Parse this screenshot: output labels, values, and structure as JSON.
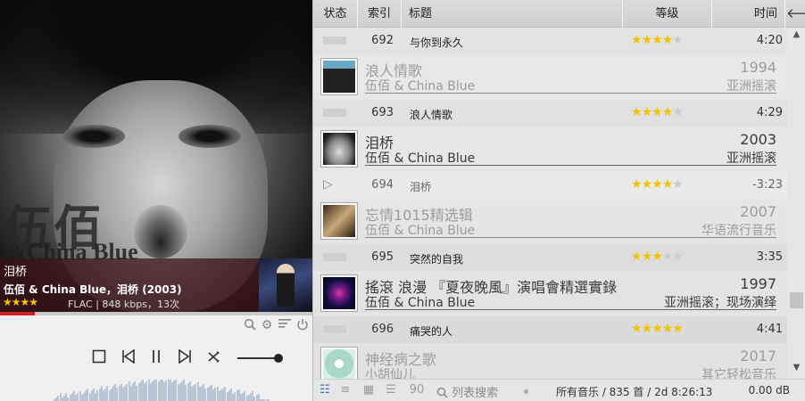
{
  "now_playing": {
    "title": "泪桥",
    "artist_line": "伍佰 & China Blue，泪桥 (2003)",
    "rating_stars": "★★★★",
    "rating": 4,
    "format_info": "FLAC | 848 kbps，13次",
    "progress_fraction": 0.11,
    "cover_text_1": "伍佰",
    "cover_text_2": "&China Blue"
  },
  "controls": {
    "volume_fraction": 0.95
  },
  "header": {
    "status": "状态",
    "index": "索引",
    "title": "标题",
    "rating": "等级",
    "time": "时间"
  },
  "rows": [
    {
      "kind": "track",
      "index": "692",
      "title": "与你到永久",
      "rating": 4,
      "duration": "4:20"
    },
    {
      "kind": "album",
      "name": "浪人情歌",
      "artist": "伍佰 & China Blue",
      "year": "1994",
      "genre": "亚洲摇滚",
      "style": "dim",
      "thumb": "t1"
    },
    {
      "kind": "track",
      "index": "693",
      "title": "浪人情歌",
      "rating": 4,
      "duration": "4:29"
    },
    {
      "kind": "album",
      "name": "泪桥",
      "artist": "伍佰 & China Blue",
      "year": "2003",
      "genre": "亚洲摇滚",
      "style": "dark",
      "thumb": "t2"
    },
    {
      "kind": "track",
      "index": "694",
      "title": "泪桥",
      "rating": 4,
      "duration": "-3:23",
      "playing": true
    },
    {
      "kind": "album",
      "name": "忘情1015精选辑",
      "artist": "伍佰 & China Blue",
      "year": "2007",
      "genre": "华语流行音乐",
      "style": "dim",
      "thumb": "t3"
    },
    {
      "kind": "track",
      "index": "695",
      "title": "突然的自我",
      "rating": 3,
      "duration": "3:35"
    },
    {
      "kind": "album",
      "name": "搖滾 浪漫 『夏夜晚風』演唱會精選實錄",
      "artist": "伍佰 & China Blue",
      "year": "1997",
      "genre": "亚洲摇滚；现场演绎",
      "style": "dark",
      "thumb": "t4"
    },
    {
      "kind": "track",
      "index": "696",
      "title": "痛哭的人",
      "rating": 5,
      "duration": "4:41"
    },
    {
      "kind": "album",
      "name": "神经病之歌",
      "artist": "小胡仙儿",
      "year": "2017",
      "genre": "其它轻松音乐",
      "style": "dim",
      "thumb": "t5"
    }
  ],
  "statusbar": {
    "search_placeholder": "列表搜索",
    "summary": "所有音乐 / 835 首 / 2d 8:26:13",
    "db": "0.00 dB"
  },
  "icons": {
    "back": "arrow-left-icon",
    "search": "search-icon",
    "settings": "gear-icon",
    "equalizer": "equalizer-icon",
    "power": "power-icon"
  },
  "colors": {
    "accent_red": "#d0202a",
    "star": "#f2c300",
    "selection_blue": "#2a6fc9"
  }
}
